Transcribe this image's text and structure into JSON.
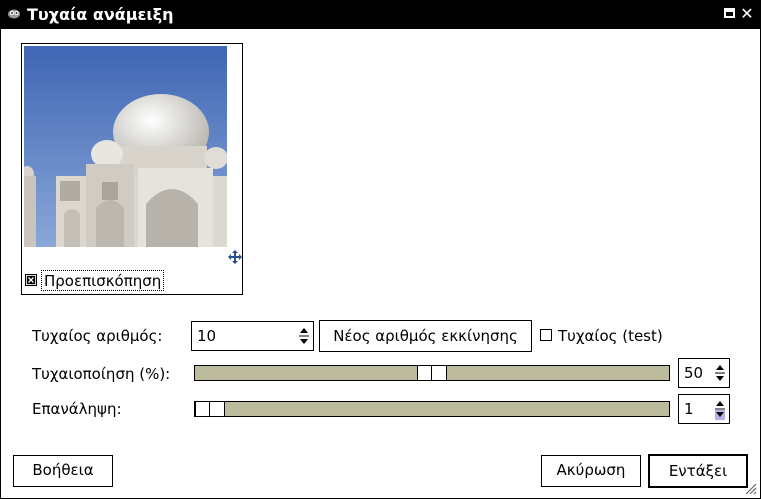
{
  "window": {
    "title": "Τυχαία ανάμειξη"
  },
  "icons": {
    "app": "gimp-wilber-icon",
    "maximize": "maximize-icon",
    "close": "close-icon",
    "navigate": "move-arrows-icon",
    "resize": "resize-grip-icon"
  },
  "preview": {
    "label": "Προεπισκόπηση",
    "checked": true,
    "image": "photo of Taj Mahal dome"
  },
  "seed": {
    "label": "Τυχαίος αριθμός:",
    "value": "10",
    "new_seed_button": "Νέος αριθμός εκκίνησης",
    "randomize_label": "Τυχαίος (test)",
    "randomize_checked": false
  },
  "randomization": {
    "label": "Τυχαιοποίηση (%):",
    "value": "50",
    "slider_fraction": 0.5
  },
  "repeat": {
    "label": "Επανάληψη:",
    "value": "1",
    "slider_fraction": 0.0
  },
  "buttons": {
    "help": "Βοήθεια",
    "cancel": "Ακύρωση",
    "ok": "Εντάξει"
  },
  "colors": {
    "slider_track": "#bcbc9c",
    "titlebar": "#000000"
  }
}
